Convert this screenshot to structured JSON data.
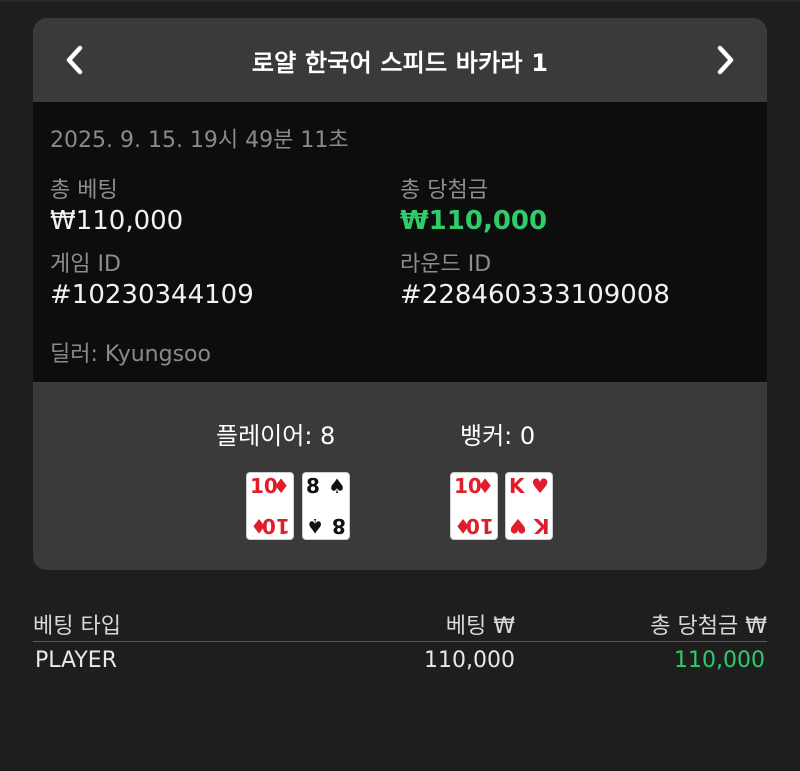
{
  "header": {
    "title": "로얄 한국어 스피드 바카라 1"
  },
  "info": {
    "datetime": "2025. 9. 15. 19시 49분 11초",
    "total_bet_label": "총 베팅",
    "total_bet_value": "₩110,000",
    "total_win_label": "총 당첨금",
    "total_win_value": "₩110,000",
    "game_id_label": "게임 ID",
    "game_id_value": "#10230344109",
    "round_id_label": "라운드 ID",
    "round_id_value": "#228460333109008",
    "dealer": "딜러: Kyungsoo"
  },
  "results": {
    "player_label": "플레이어: 8",
    "banker_label": "뱅커: 0",
    "player_cards": [
      {
        "rank": "10",
        "suit": "♦",
        "color": "red"
      },
      {
        "rank": "8",
        "suit": "♠",
        "color": "black"
      }
    ],
    "banker_cards": [
      {
        "rank": "10",
        "suit": "♦",
        "color": "red"
      },
      {
        "rank": "K",
        "suit": "♥",
        "color": "red"
      }
    ]
  },
  "table": {
    "headers": [
      "베팅 타입",
      "베팅 ₩",
      "총 당첨금 ₩"
    ],
    "rows": [
      {
        "type": "PLAYER",
        "bet": "110,000",
        "win": "110,000"
      }
    ]
  },
  "colors": {
    "win_green": "#2ecc6a",
    "panel_bg": "#3a3a3a",
    "info_bg": "#0d0d0d"
  }
}
